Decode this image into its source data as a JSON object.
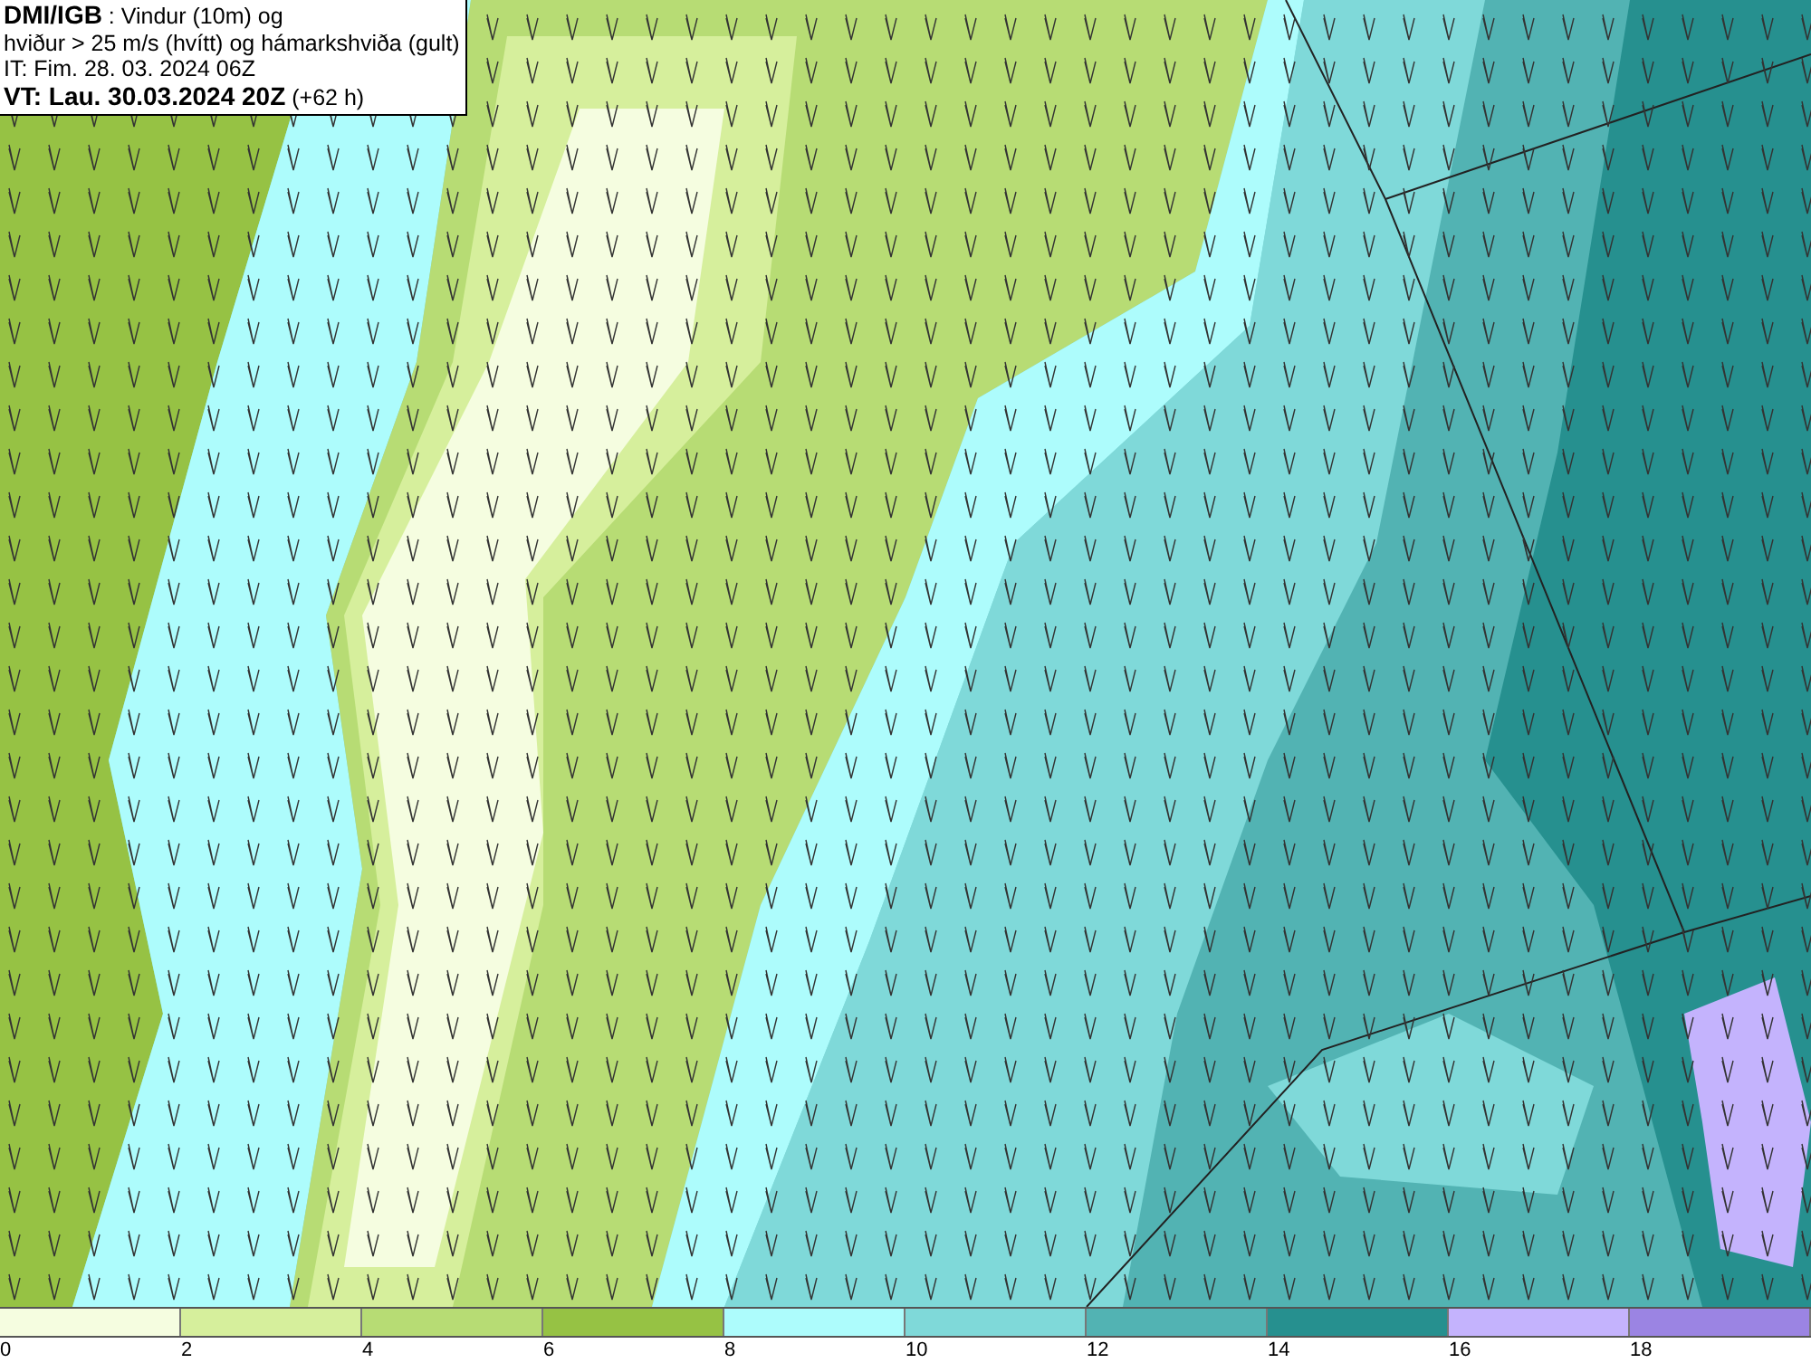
{
  "info": {
    "lines": [
      "**DMI/IGB** : Vindur (10m) og",
      "hviður > 25 m/s (hvítt) og hámarkshviða (gult)",
      "IT: Fim. 28. 03. 2024 06Z",
      "**VT: Lau. 30.03.2024 20Z** (+62 h)"
    ]
  },
  "legend": {
    "bins": [
      {
        "color": "#f5fde0"
      },
      {
        "color": "#d6ef9c"
      },
      {
        "color": "#b7dc74"
      },
      {
        "color": "#96c244"
      },
      {
        "color": "#adfcfc"
      },
      {
        "color": "#7fd9d9"
      },
      {
        "color": "#52b3b3"
      },
      {
        "color": "#26908f"
      },
      {
        "color": "#c4b3fd"
      },
      {
        "color": "#9b84e3"
      }
    ],
    "ticks": [
      "0",
      "2",
      "4",
      "6",
      "8",
      "10",
      "12",
      "14",
      "16",
      "18"
    ]
  }
}
